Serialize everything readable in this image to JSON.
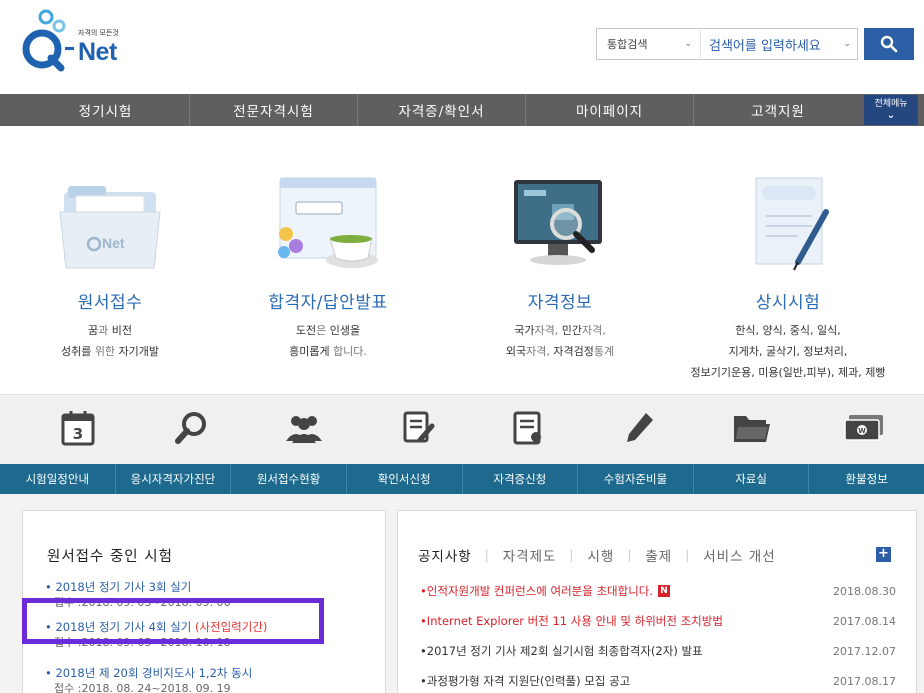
{
  "header": {
    "logo_text": "Net",
    "logo_tagline": "자격의 모든것",
    "search_scope": "통합검색",
    "search_placeholder": "검색어를 입력하세요"
  },
  "topnav": {
    "items": [
      "정기시험",
      "전문자격시험",
      "자격증/확인서",
      "마이페이지",
      "고객지원"
    ],
    "all_menu": "전체메뉴"
  },
  "hero": {
    "cards": [
      {
        "title": "원서접수",
        "desc1": [
          "꿈",
          "과 ",
          "비전"
        ],
        "desc2": [
          "성취를 ",
          "위한 ",
          "자기개발"
        ]
      },
      {
        "title": "합격자/답안발표",
        "desc1": [
          "도전",
          "은 ",
          "인생을"
        ],
        "desc2": [
          "흥미롭게 ",
          "합니다."
        ]
      },
      {
        "title": "자격정보",
        "desc1": [
          "국가",
          "자격, ",
          "민간",
          "자격,"
        ],
        "desc2": [
          "외국",
          "자격, ",
          "자격검정",
          "통계"
        ]
      },
      {
        "title": "상시시험",
        "desc1": "한식, 양식, 중식, 일식,",
        "desc2": "지게차, 굴삭기, 정보처리,",
        "desc3": "정보기기운용, 미용(일반,피부), 제과, 제빵"
      }
    ]
  },
  "quick": {
    "labels": [
      "시험일정안내",
      "응시자격자가진단",
      "원서접수현황",
      "확인서신청",
      "자격증신청",
      "수험자준비물",
      "자료실",
      "환불정보"
    ],
    "calendar_day": "3"
  },
  "exam_box": {
    "title": "원서접수 중인 시험",
    "items": [
      {
        "name": "2018년 정기 기사 3회 실기",
        "period": "접수 :2018. 09. 03~2018. 09. 06"
      },
      {
        "name": "2018년 정기 기사 4회 실기 ",
        "note": "(사전입력기간)",
        "period": "접수 :2018. 09. 05~2018. 10. 18"
      },
      {
        "name": "2018년 제 20회 경비지도사 1,2차 동시",
        "period": "접수 :2018. 08. 24~2018. 09. 19"
      }
    ]
  },
  "notice_box": {
    "tabs": [
      "공지사항",
      "자격제도",
      "시행",
      "출제",
      "서비스 개선"
    ],
    "items": [
      {
        "title": "인적자원개발 컨퍼런스에 여러분을 초대합니다.",
        "date": "2018.08.30",
        "badge": "N"
      },
      {
        "title": "Internet Explorer 버전 11 사용 안내 및 하위버전 조치방법",
        "date": "2017.08.14"
      },
      {
        "title": "2017년 정기 기사 제2회 실기시험 최종합격자(2자) 발표",
        "date": "2017.12.07"
      },
      {
        "title": "과정평가형 자격 지원단(인력풀) 모집 공고",
        "date": "2017.08.17"
      }
    ]
  },
  "colors": {
    "brand_blue": "#2d5fa6",
    "nav_gray": "#5f5f62",
    "quickbar_teal": "#1d6a8e",
    "alert_red": "#d8212a",
    "annotation_purple": "#6c2bd9"
  }
}
